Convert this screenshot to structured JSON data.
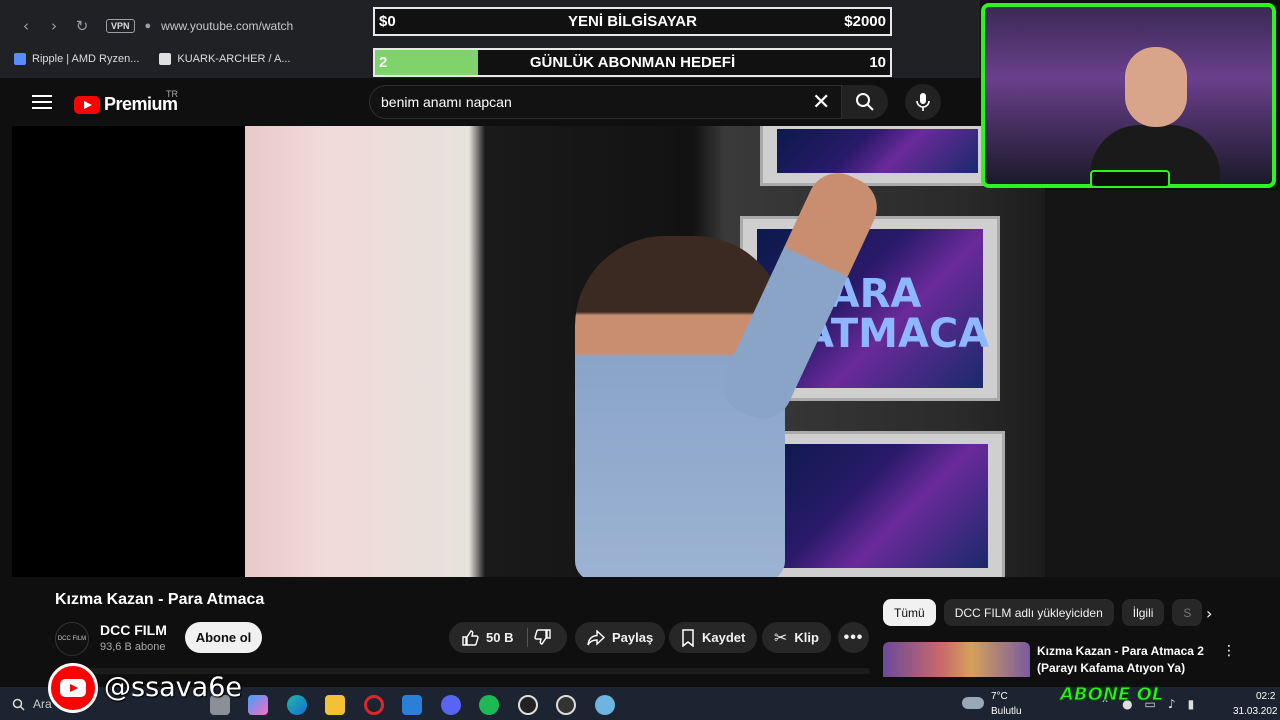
{
  "browser": {
    "url": "www.youtube.com/watch",
    "vpn_label": "VPN",
    "bookmarks": [
      {
        "label": "Ripple | AMD Ryzen...",
        "color": "#5b8cff"
      },
      {
        "label": "KUARK-ARCHER / A...",
        "color": "#e0e0e0"
      }
    ]
  },
  "overlay": {
    "goal1": {
      "left": "$0",
      "title": "YENİ BİLGİSAYAR",
      "right": "$2000"
    },
    "goal2": {
      "left": "2",
      "title": "GÜNLÜK ABONMAN HEDEFİ",
      "right": "10",
      "progress": 0.2
    },
    "social_handle": "@ssava6e",
    "abone_badge": "ABONE OL"
  },
  "youtube": {
    "logo_text": "Premium",
    "region": "TR",
    "search_value": "benim anamı napcan",
    "video": {
      "title": "Kızma Kazan - Para Atmaca",
      "screen_text": "PARA ATMACA",
      "channel": {
        "name": "DCC FILM",
        "avatar_text": "DCC FILM",
        "subscribers": "93,6 B abone"
      },
      "subscribe_label": "Abone ol",
      "like_count": "50 B",
      "share_label": "Paylaş",
      "save_label": "Kaydet",
      "clip_label": "Klip"
    },
    "chips": [
      "Tümü",
      "DCC FILM adlı yükleyiciden",
      "İlgili",
      "S"
    ],
    "related": [
      {
        "title": "Kızma Kazan - Para Atmaca 2 (Parayı Kafama Atıyon Ya)"
      }
    ]
  },
  "taskbar": {
    "search_label": "Ara",
    "weather": {
      "temp": "7°C",
      "desc": "Bulutlu"
    },
    "clock": {
      "time": "02:2",
      "date": "31.03.202"
    },
    "icons": [
      "folder-icon",
      "edge-icon",
      "files-icon",
      "opera-icon",
      "mail-icon",
      "discord-icon",
      "spotify-icon",
      "obs-icon",
      "media-icon",
      "app-icon"
    ]
  },
  "colors": {
    "accent_green": "#2ff31e",
    "youtube_red": "#ff0000",
    "goal_fill": "#7ed36b"
  }
}
